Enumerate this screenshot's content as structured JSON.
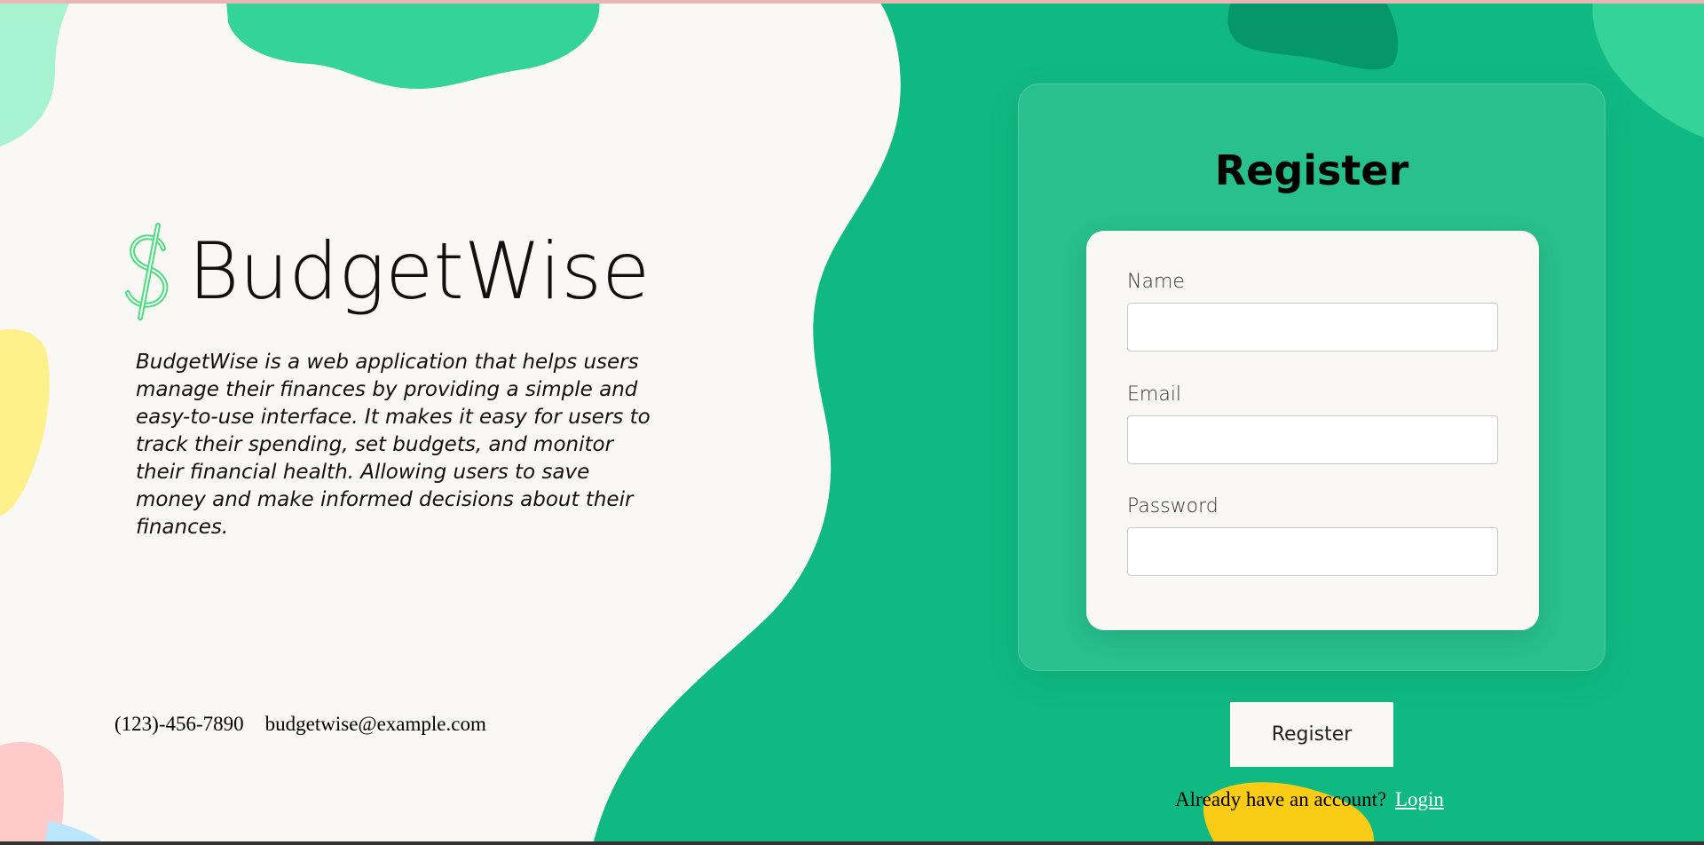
{
  "colors": {
    "primary_green": "#10b981",
    "light_green": "#34d399",
    "dark_green": "#059669",
    "cream": "#f9f8f5",
    "yellow": "#fcd34d",
    "pink": "#fecaca",
    "mint": "#a7f3d0",
    "dollar_green": "#4ade80"
  },
  "brand": {
    "icon": "dollar-sign-icon",
    "name": "BudgetWise",
    "description": "BudgetWise is a web application that helps users manage their finances by providing a simple and easy-to-use interface. It makes it easy for users to track their spending, set budgets, and monitor their financial health. Allowing users to save money and make informed decisions about their finances."
  },
  "contact": {
    "phone": "(123)-456-7890",
    "email": "budgetwise@example.com"
  },
  "register_form": {
    "title": "Register",
    "fields": [
      {
        "label": "Name",
        "value": "",
        "type": "text"
      },
      {
        "label": "Email",
        "value": "",
        "type": "email"
      },
      {
        "label": "Password",
        "value": "",
        "type": "password"
      }
    ],
    "submit_label": "Register",
    "login_prompt": "Already have an account?",
    "login_link": "Login"
  }
}
